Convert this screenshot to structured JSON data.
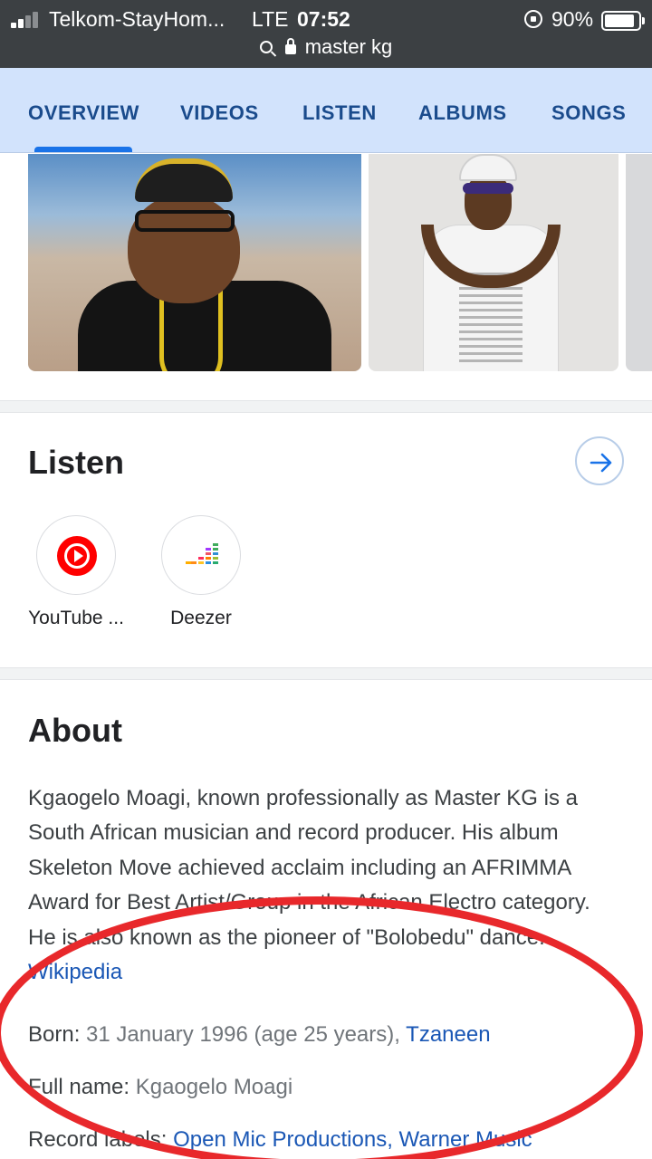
{
  "status_bar": {
    "carrier": "Telkom-StayHom...",
    "network": "LTE",
    "time": "07:52",
    "battery": "90%",
    "battery_level": 0.9
  },
  "url_bar": {
    "query": "master kg"
  },
  "tabs": [
    "OVERVIEW",
    "VIDEOS",
    "LISTEN",
    "ALBUMS",
    "SONGS"
  ],
  "listen": {
    "title": "Listen",
    "providers": [
      {
        "name": "YouTube ...",
        "icon": "youtube-music-icon"
      },
      {
        "name": "Deezer",
        "icon": "deezer-icon"
      }
    ]
  },
  "about": {
    "title": "About",
    "description": "Kgaogelo Moagi, known professionally as Master KG is a South African musician and record producer. His album Skeleton Move achieved acclaim including an AFRIMMA Award for Best Artist/Group in the African Electro category. He is also known as the pioneer of \"Bolobedu\" dance.",
    "source_link": "Wikipedia",
    "born_label": "Born",
    "born_value": "31 January 1996 (age 25 years),",
    "born_place": "Tzaneen",
    "fullname_label": "Full name",
    "fullname_value": "Kgaogelo Moagi",
    "labels_label": "Record labels",
    "labels_value_1": "Open Mic Productions,",
    "labels_value_2": "Warner Music"
  },
  "colors": {
    "tab_bar": "#d2e3fc",
    "tab_text": "#1a4b8c",
    "link": "#1a57b5",
    "annotation": "#e8282b",
    "status_bar": "#3c4043"
  }
}
